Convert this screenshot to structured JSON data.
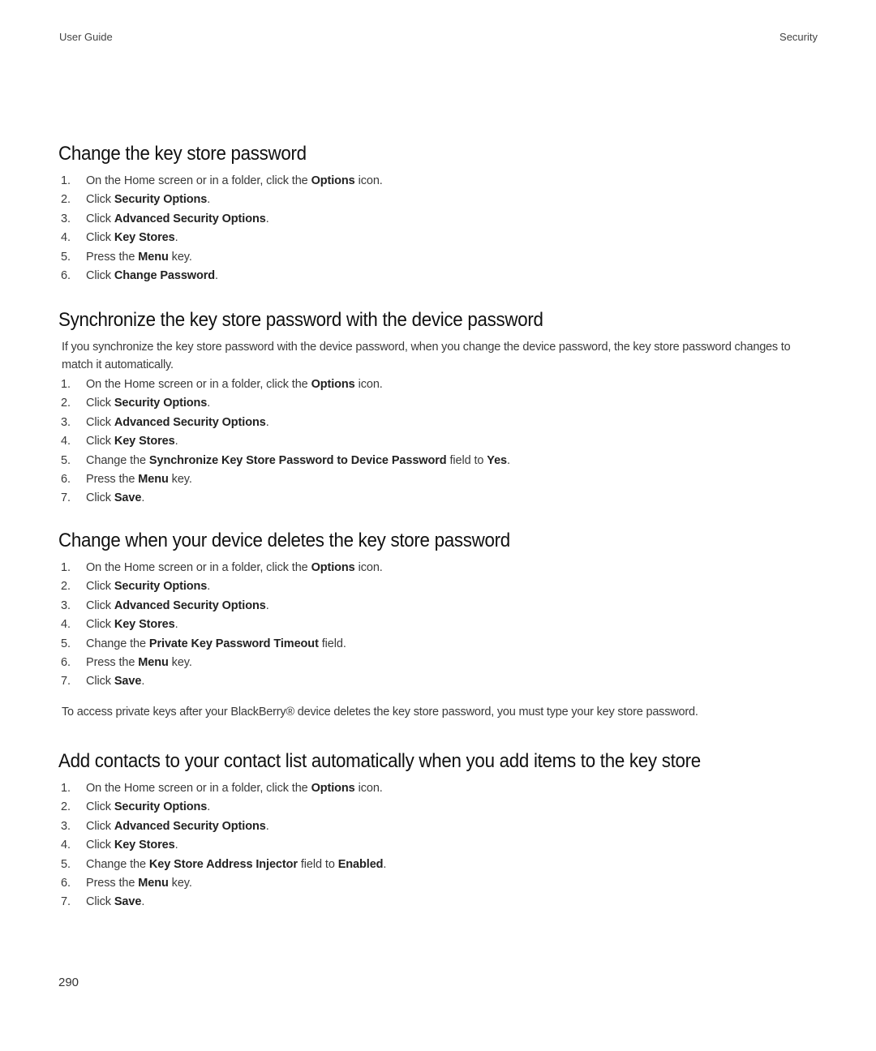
{
  "header": {
    "left": "User Guide",
    "right": "Security"
  },
  "sections": [
    {
      "title": "Change the key store password",
      "steps": [
        [
          {
            "t": "On the Home screen or in a folder, click the "
          },
          {
            "b": "Options"
          },
          {
            "t": " icon."
          }
        ],
        [
          {
            "t": "Click "
          },
          {
            "b": "Security Options"
          },
          {
            "t": "."
          }
        ],
        [
          {
            "t": "Click "
          },
          {
            "b": "Advanced Security Options"
          },
          {
            "t": "."
          }
        ],
        [
          {
            "t": "Click "
          },
          {
            "b": "Key Stores"
          },
          {
            "t": "."
          }
        ],
        [
          {
            "t": "Press the "
          },
          {
            "b": "Menu"
          },
          {
            "t": " key."
          }
        ],
        [
          {
            "t": "Click "
          },
          {
            "b": "Change Password"
          },
          {
            "t": "."
          }
        ]
      ]
    },
    {
      "title": "Synchronize the key store password with the device password",
      "intro": "If you synchronize the key store password with the device password, when you change the device password, the key store password changes to match it automatically.",
      "steps": [
        [
          {
            "t": "On the Home screen or in a folder, click the "
          },
          {
            "b": "Options"
          },
          {
            "t": " icon."
          }
        ],
        [
          {
            "t": "Click "
          },
          {
            "b": "Security Options"
          },
          {
            "t": "."
          }
        ],
        [
          {
            "t": "Click "
          },
          {
            "b": "Advanced Security Options"
          },
          {
            "t": "."
          }
        ],
        [
          {
            "t": "Click "
          },
          {
            "b": "Key Stores"
          },
          {
            "t": "."
          }
        ],
        [
          {
            "t": "Change the "
          },
          {
            "b": "Synchronize Key Store Password to Device Password"
          },
          {
            "t": " field to "
          },
          {
            "b": "Yes"
          },
          {
            "t": "."
          }
        ],
        [
          {
            "t": "Press the "
          },
          {
            "b": "Menu"
          },
          {
            "t": " key."
          }
        ],
        [
          {
            "t": "Click "
          },
          {
            "b": "Save"
          },
          {
            "t": "."
          }
        ]
      ]
    },
    {
      "title": "Change when your device deletes the key store password",
      "steps": [
        [
          {
            "t": "On the Home screen or in a folder, click the "
          },
          {
            "b": "Options"
          },
          {
            "t": " icon."
          }
        ],
        [
          {
            "t": "Click "
          },
          {
            "b": "Security Options"
          },
          {
            "t": "."
          }
        ],
        [
          {
            "t": "Click "
          },
          {
            "b": "Advanced Security Options"
          },
          {
            "t": "."
          }
        ],
        [
          {
            "t": "Click "
          },
          {
            "b": "Key Stores"
          },
          {
            "t": "."
          }
        ],
        [
          {
            "t": "Change the "
          },
          {
            "b": "Private Key Password Timeout"
          },
          {
            "t": " field."
          }
        ],
        [
          {
            "t": "Press the "
          },
          {
            "b": "Menu"
          },
          {
            "t": " key."
          }
        ],
        [
          {
            "t": "Click "
          },
          {
            "b": "Save"
          },
          {
            "t": "."
          }
        ]
      ],
      "note": "To access private keys after your BlackBerry® device deletes the key store password, you must type your key store password."
    },
    {
      "title": "Add contacts to your contact list automatically when you add items to the key store",
      "steps": [
        [
          {
            "t": "On the Home screen or in a folder, click the "
          },
          {
            "b": "Options"
          },
          {
            "t": " icon."
          }
        ],
        [
          {
            "t": "Click "
          },
          {
            "b": "Security Options"
          },
          {
            "t": "."
          }
        ],
        [
          {
            "t": "Click "
          },
          {
            "b": "Advanced Security Options"
          },
          {
            "t": "."
          }
        ],
        [
          {
            "t": "Click "
          },
          {
            "b": "Key Stores"
          },
          {
            "t": "."
          }
        ],
        [
          {
            "t": "Change the "
          },
          {
            "b": "Key Store Address Injector"
          },
          {
            "t": " field to "
          },
          {
            "b": "Enabled"
          },
          {
            "t": "."
          }
        ],
        [
          {
            "t": "Press the "
          },
          {
            "b": "Menu"
          },
          {
            "t": " key."
          }
        ],
        [
          {
            "t": "Click "
          },
          {
            "b": "Save"
          },
          {
            "t": "."
          }
        ]
      ]
    }
  ],
  "footer": {
    "page_number": "290"
  }
}
